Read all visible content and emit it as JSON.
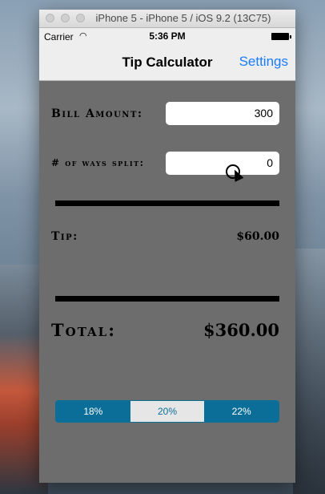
{
  "window": {
    "title": "iPhone 5 - iPhone 5 / iOS 9.2 (13C75)"
  },
  "status": {
    "carrier": "Carrier",
    "time": "5:36 PM"
  },
  "nav": {
    "title": "Tip Calculator",
    "settings_label": "Settings"
  },
  "form": {
    "bill_label": "Bill Amount:",
    "bill_value": "300",
    "split_label": "# of ways split:",
    "split_value": "0"
  },
  "results": {
    "tip_label": "Tip:",
    "tip_value": "$60.00",
    "total_label": "Total:",
    "total_value": "$360.00"
  },
  "tip_options": [
    {
      "label": "18%",
      "selected": false
    },
    {
      "label": "20%",
      "selected": true
    },
    {
      "label": "22%",
      "selected": false
    }
  ]
}
